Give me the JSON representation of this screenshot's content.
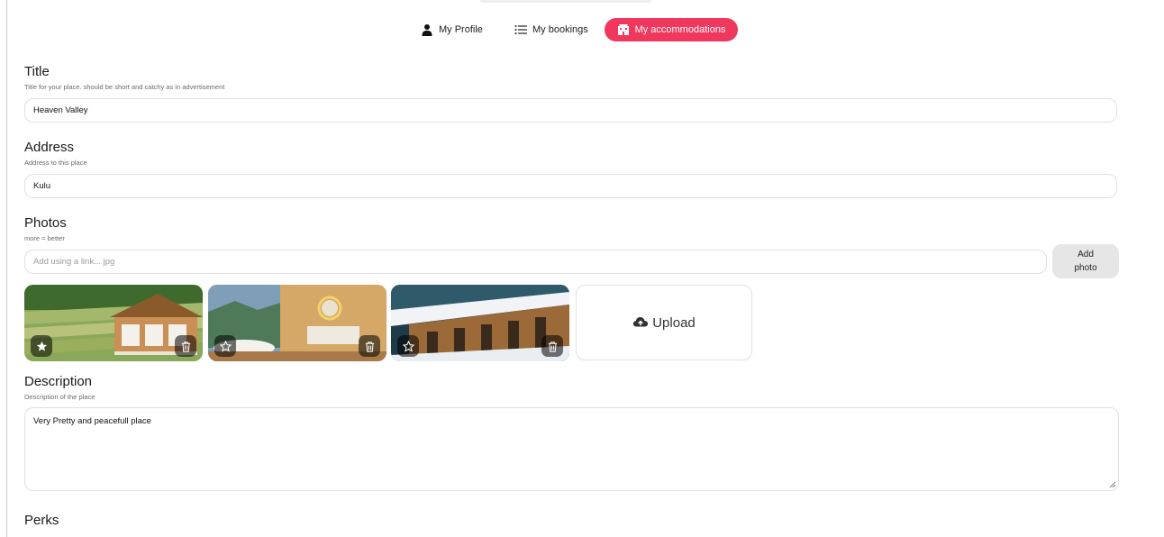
{
  "nav": {
    "profile_label": "My Profile",
    "bookings_label": "My bookings",
    "accommodations_label": "My accommodations",
    "active_color": "#f0375d"
  },
  "title": {
    "heading": "Title",
    "hint": "Title for your place. should be short and catchy as in advertisement",
    "value": "Heaven Valley"
  },
  "address": {
    "heading": "Address",
    "hint": "Address to this place",
    "value": "Kulu"
  },
  "photos": {
    "heading": "Photos",
    "hint": "more = better",
    "link_placeholder": "Add using a link... jpg",
    "add_button_line1": "Add",
    "add_button_line2": "photo",
    "upload_label": "Upload",
    "items": [
      {
        "subject": "wooden chalet on terraced hillside",
        "main": true
      },
      {
        "subject": "bathroom with bathtub overlooking mountain valley",
        "main": false
      },
      {
        "subject": "snow covered cabin roof",
        "main": false
      }
    ]
  },
  "description": {
    "heading": "Description",
    "hint": "Description of the place",
    "value": "Very Pretty and peacefull place"
  },
  "perks": {
    "heading": "Perks"
  }
}
